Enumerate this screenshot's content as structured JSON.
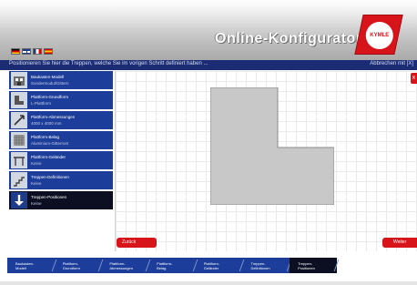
{
  "header": {
    "title": "Online-Konfigurator",
    "logo_text": "KYMLE",
    "flags": [
      "de",
      "gb",
      "fr",
      "es"
    ]
  },
  "instruction": {
    "text": "Positionieren Sie hier die Treppen, welche Sie im vorigen Schritt definiert haben ...",
    "cancel": "Abbrechen mit [X]"
  },
  "steps": [
    {
      "title": "Baukasten-Modell",
      "value": "Sondermodul/Gittern",
      "icon": "building-icon"
    },
    {
      "title": "Plattform-Grundform",
      "value": "L-Plattform",
      "icon": "l-shape-icon"
    },
    {
      "title": "Plattform-Abmessungen",
      "value": "4000 x 4000 mm",
      "icon": "dimensions-icon"
    },
    {
      "title": "Plattform-Belag",
      "value": "Aluminium-Gitterrost",
      "icon": "grating-icon"
    },
    {
      "title": "Plattform-Geländer",
      "value": "Keine",
      "icon": "railing-icon"
    },
    {
      "title": "Treppen-Definitionen",
      "value": "Keine",
      "icon": "stairs-icon"
    },
    {
      "title": "Treppen-Positionen",
      "value": "Keine",
      "icon": "arrow-down-icon",
      "active": true
    }
  ],
  "canvas": {
    "close_label": "x",
    "back_label": "Zurück",
    "next_label": "Weiter",
    "platform_color": "#c8c8c8"
  },
  "breadcrumb": [
    {
      "line1": "Baukasten-",
      "line2": "Modell"
    },
    {
      "line1": "Plattform-",
      "line2": "Grundform"
    },
    {
      "line1": "Plattform-",
      "line2": "Abmessungen"
    },
    {
      "line1": "Plattform-",
      "line2": "Belag"
    },
    {
      "line1": "Plattform-",
      "line2": "Geländer"
    },
    {
      "line1": "Treppen-",
      "line2": "Definitionen"
    },
    {
      "line1": "Treppen-",
      "line2": "Positionen",
      "active": true
    }
  ],
  "colors": {
    "brand_red": "#d8141b",
    "nav_blue": "#1c3e9a",
    "active_dark": "#0c0f22"
  }
}
